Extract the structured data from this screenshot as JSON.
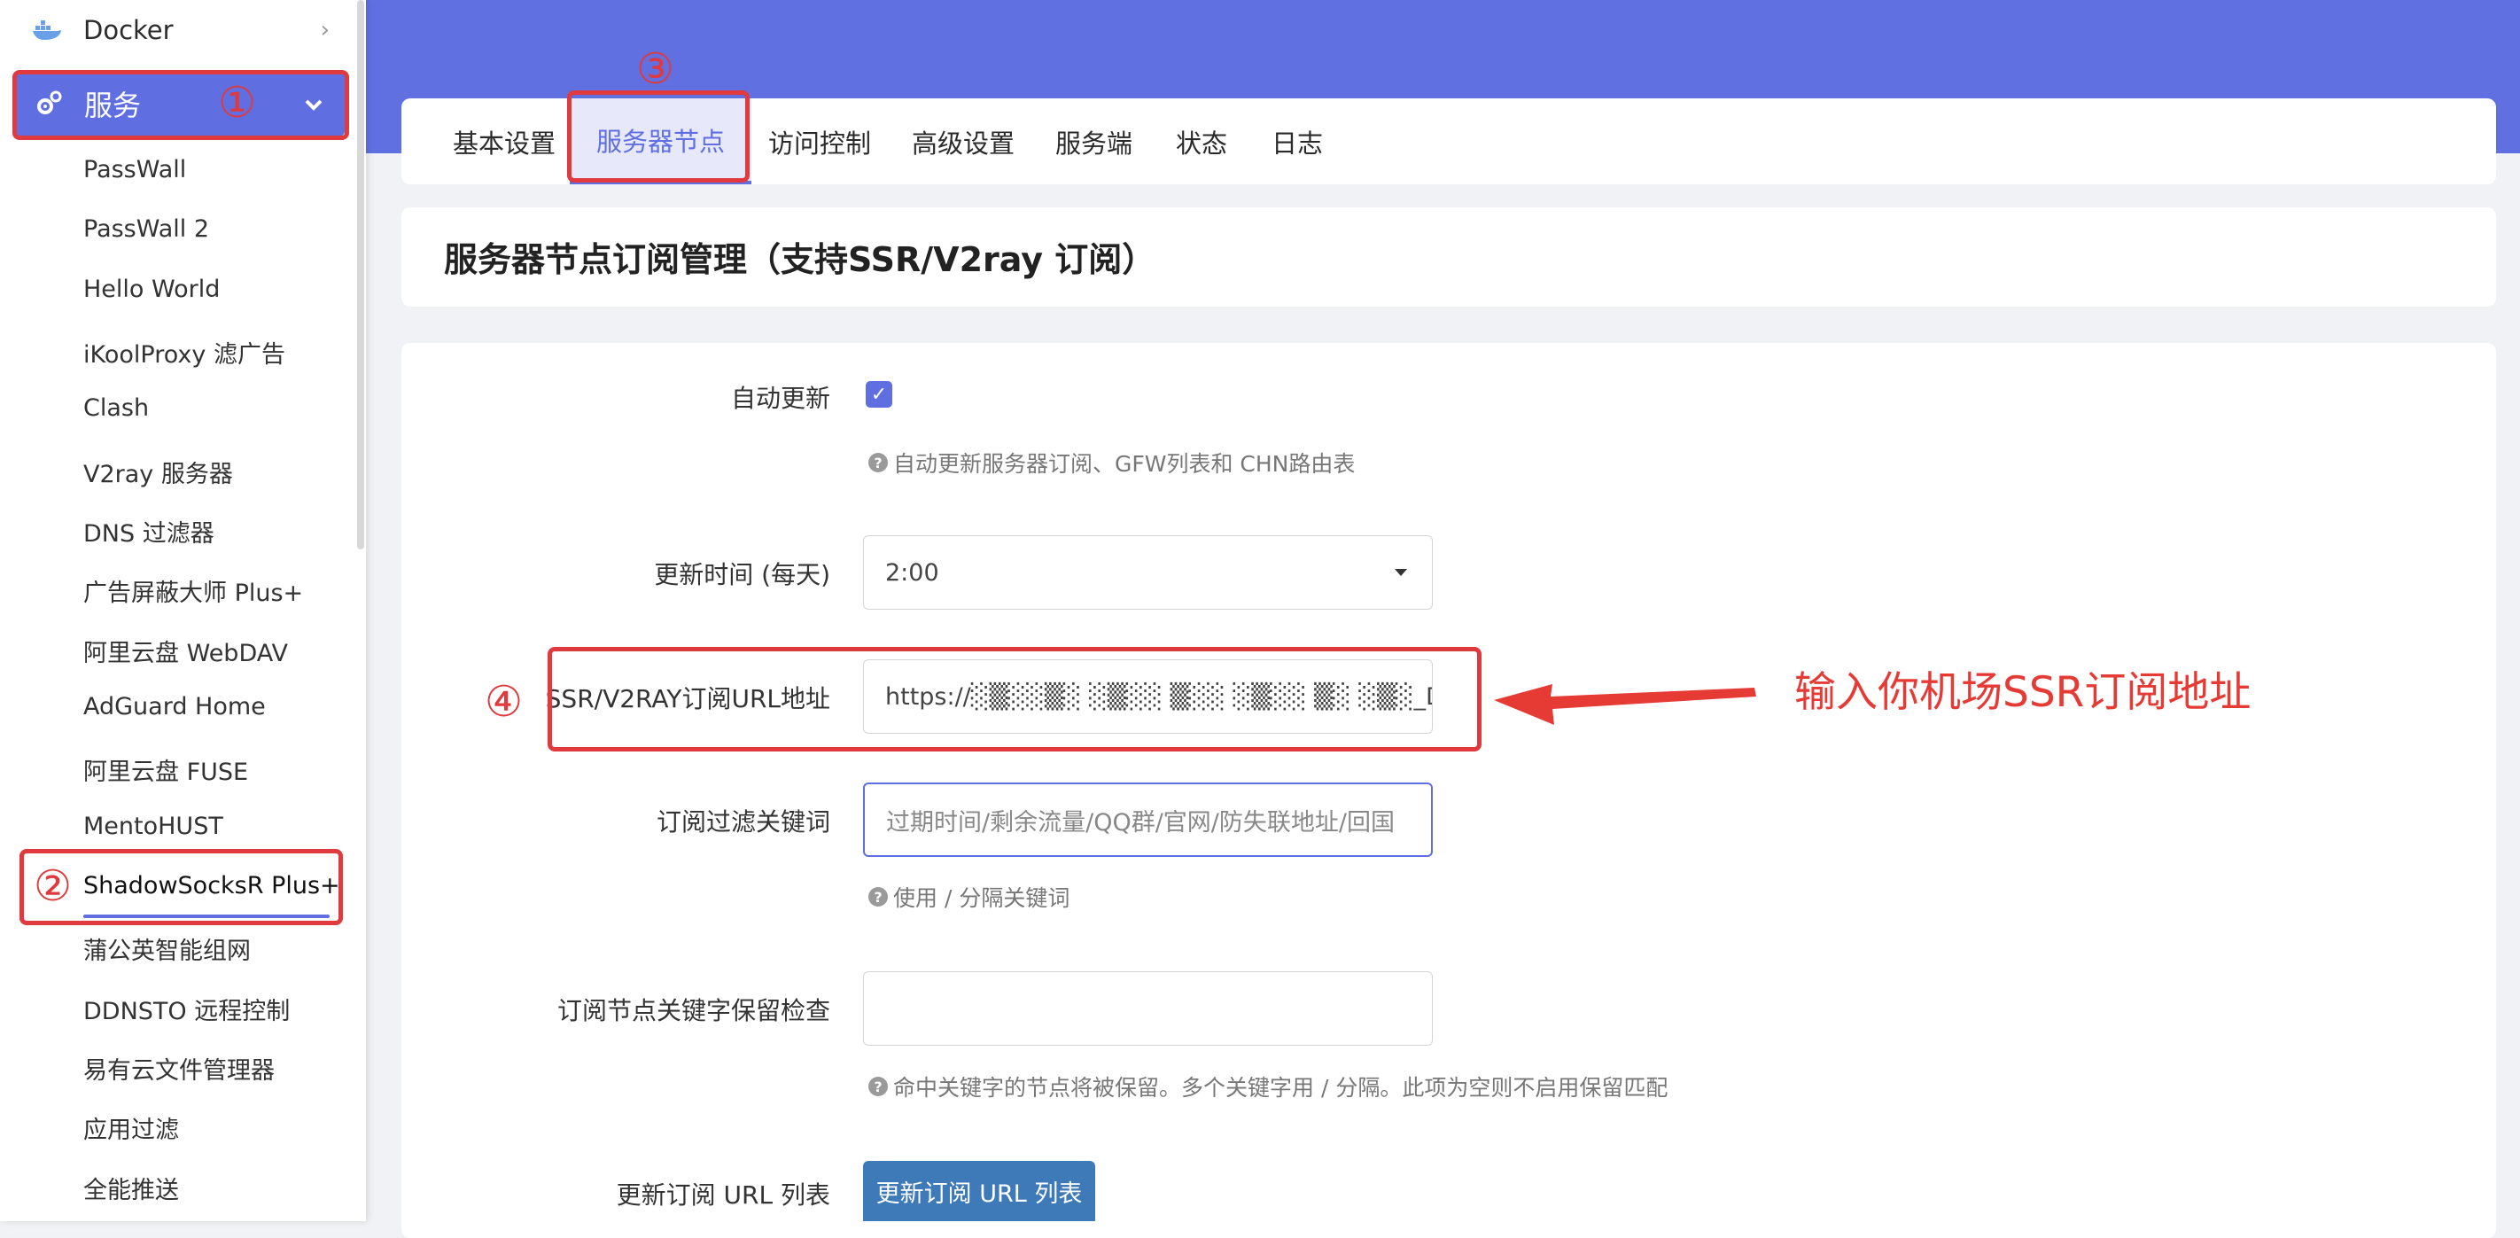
{
  "sidebar": {
    "docker_label": "Docker",
    "service_label": "服务",
    "items": [
      "PassWall",
      "PassWall 2",
      "Hello World",
      "iKoolProxy 滤广告",
      "Clash",
      "V2ray 服务器",
      "DNS 过滤器",
      "广告屏蔽大师 Plus+",
      "阿里云盘 WebDAV",
      "AdGuard Home",
      "阿里云盘 FUSE",
      "MentoHUST",
      "ShadowSocksR Plus+",
      "蒲公英智能组网",
      "DDNSTO 远程控制",
      "易有云文件管理器",
      "应用过滤",
      "全能推送"
    ],
    "active_item": "ShadowSocksR Plus+"
  },
  "tabs": [
    "基本设置",
    "服务器节点",
    "访问控制",
    "高级设置",
    "服务端",
    "状态",
    "日志"
  ],
  "active_tab": "服务器节点",
  "page_title": "服务器节点订阅管理（支持SSR/V2ray 订阅）",
  "form": {
    "auto_update_label": "自动更新",
    "auto_update_checked": true,
    "auto_update_hint": "自动更新服务器订阅、GFW列表和 CHN路由表",
    "update_time_label": "更新时间 (每天)",
    "update_time_value": "2:00",
    "sub_url_label": "SSR/V2RAY订阅URL地址",
    "sub_url_value": "https://░▒░░▒░ ░▒░░ ▒░░ ░▒░░ ▒░ ░▒░_DIDdc",
    "filter_label": "订阅过滤关键词",
    "filter_placeholder": "过期时间/剩余流量/QQ群/官网/防失联地址/回国",
    "filter_hint": "使用 / 分隔关键词",
    "keep_label": "订阅节点关键字保留检查",
    "keep_value": "",
    "keep_hint": "命中关键字的节点将被保留。多个关键字用 / 分隔。此项为空则不启用保留匹配",
    "update_list_label": "更新订阅 URL 列表",
    "update_list_button": "更新订阅 URL 列表"
  },
  "annotations": {
    "n1": "①",
    "n2": "②",
    "n3": "③",
    "n4": "④",
    "arrow_text": "输入你机场SSR订阅地址",
    "color": "#e0393e"
  },
  "colors": {
    "accent": "#5f6ee0",
    "button": "#3f7ab8"
  }
}
